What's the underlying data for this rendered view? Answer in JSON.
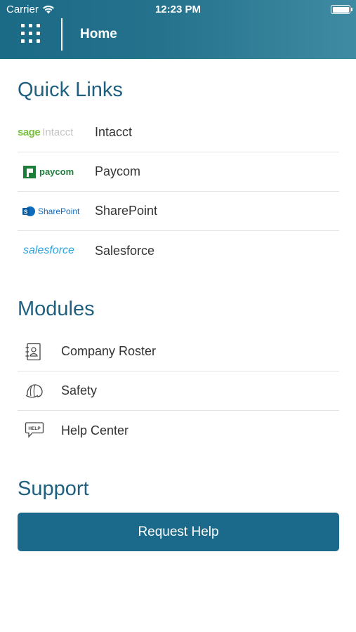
{
  "status_bar": {
    "carrier": "Carrier",
    "time": "12:23 PM"
  },
  "header": {
    "title": "Home"
  },
  "quick_links": {
    "title": "Quick Links",
    "items": [
      {
        "logo_text_a": "sage",
        "logo_text_b": "Intacct",
        "label": "Intacct"
      },
      {
        "logo_text": "paycom",
        "label": "Paycom"
      },
      {
        "logo_text": "SharePoint",
        "label": "SharePoint"
      },
      {
        "logo_text": "salesforce",
        "label": "Salesforce"
      }
    ]
  },
  "modules": {
    "title": "Modules",
    "items": [
      {
        "icon": "contact-book-icon",
        "label": "Company Roster"
      },
      {
        "icon": "hard-hat-icon",
        "label": "Safety"
      },
      {
        "icon": "help-bubble-icon",
        "icon_text": "HELP",
        "label": "Help Center"
      }
    ]
  },
  "support": {
    "title": "Support",
    "button_label": "Request Help"
  },
  "colors": {
    "header_start": "#1b6a86",
    "header_end": "#3f8ba3",
    "section_title": "#1f5f7f",
    "button": "#1b6a8c",
    "sage_green": "#7ac142",
    "paycom_green": "#1b7f3a",
    "sharepoint_blue": "#0f6cbd",
    "salesforce_blue": "#2fa3dc"
  }
}
